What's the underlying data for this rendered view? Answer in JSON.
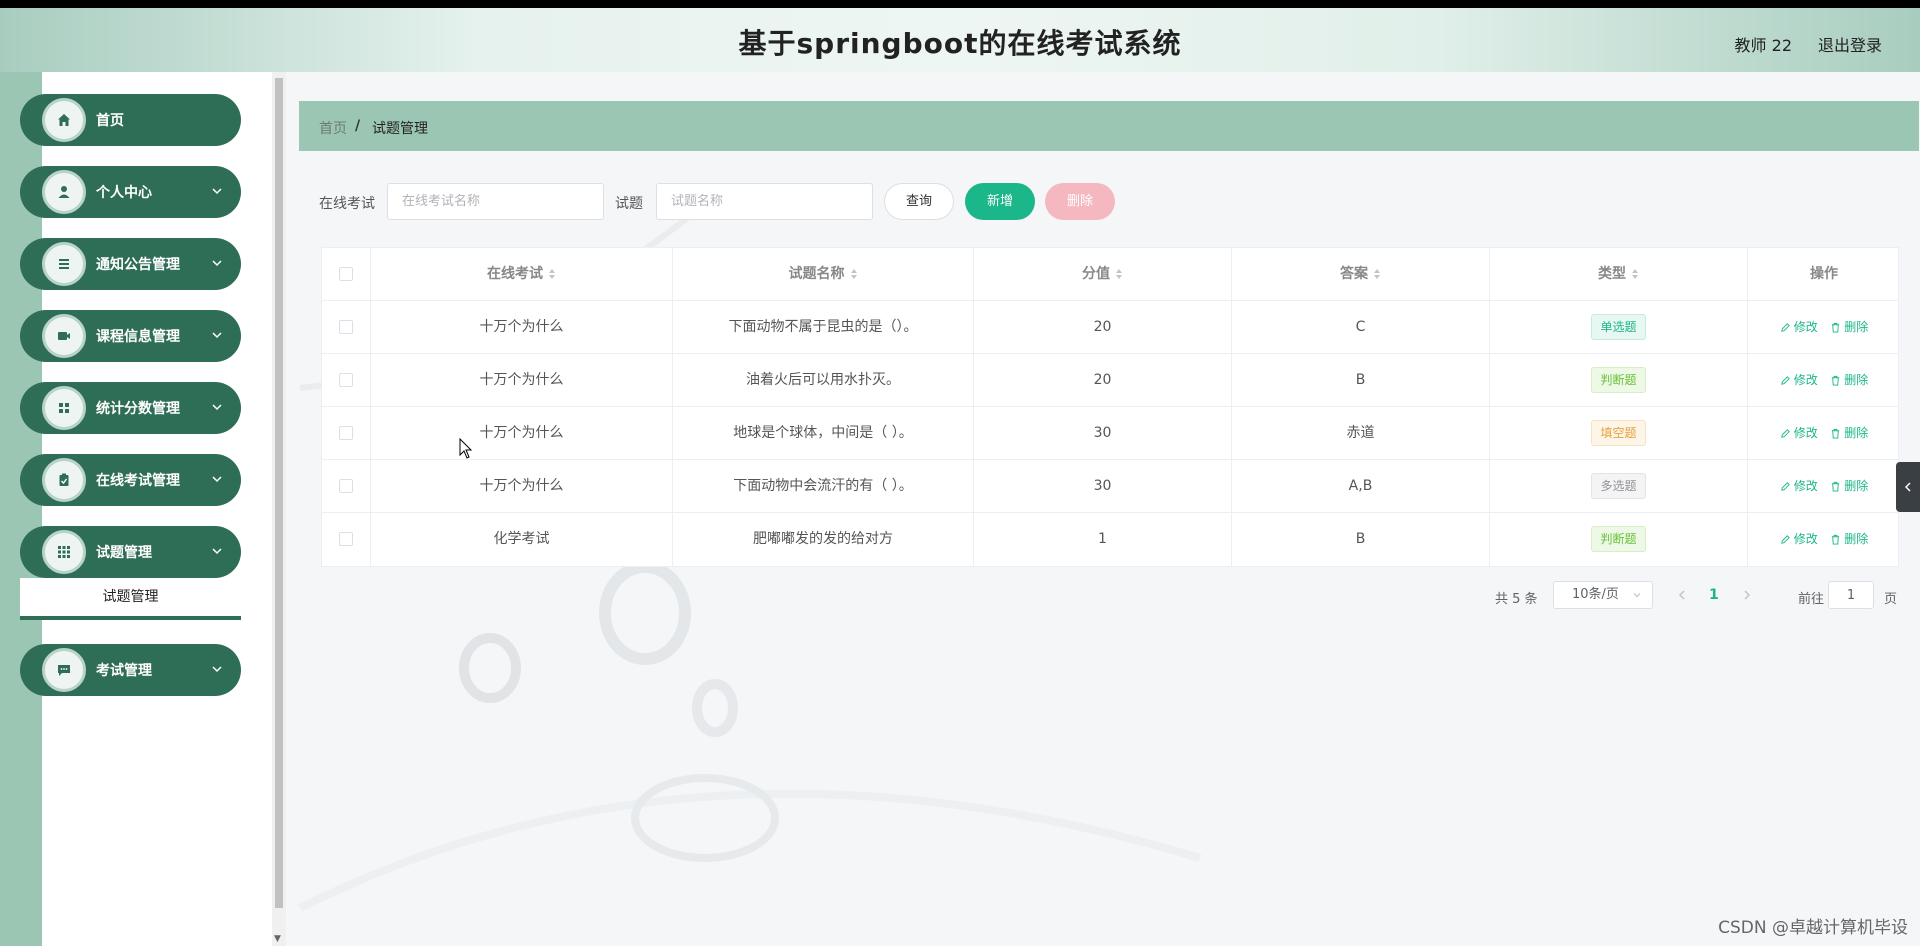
{
  "header": {
    "title": "基于springboot的在线考试系统",
    "user": "教师 22",
    "logout": "退出登录"
  },
  "sidebar": {
    "items": [
      {
        "label": "首页",
        "icon": "home-icon"
      },
      {
        "label": "个人中心",
        "icon": "user-icon"
      },
      {
        "label": "通知公告管理",
        "icon": "list-icon"
      },
      {
        "label": "课程信息管理",
        "icon": "video-icon"
      },
      {
        "label": "统计分数管理",
        "icon": "grid-icon"
      },
      {
        "label": "在线考试管理",
        "icon": "clipboard-icon"
      },
      {
        "label": "试题管理",
        "icon": "apps-icon"
      },
      {
        "label": "考试管理",
        "icon": "chat-icon"
      }
    ],
    "subitem": "试题管理"
  },
  "breadcrumb": {
    "home": "首页",
    "separator": "/",
    "current": "试题管理"
  },
  "search": {
    "exam_label": "在线考试",
    "exam_placeholder": "在线考试名称",
    "question_label": "试题",
    "question_placeholder": "试题名称",
    "query_btn": "查询",
    "add_btn": "新增",
    "delete_btn": "删除"
  },
  "table": {
    "headers": [
      "在线考试",
      "试题名称",
      "分值",
      "答案",
      "类型",
      "操作"
    ],
    "edit_label": "修改",
    "delete_label": "删除",
    "rows": [
      {
        "exam": "十万个为什么",
        "question": "下面动物不属于昆虫的是（）。",
        "score": "20",
        "answer": "C",
        "type": "单选题",
        "type_key": "single"
      },
      {
        "exam": "十万个为什么",
        "question": "油着火后可以用水扑灭。",
        "score": "20",
        "answer": "B",
        "type": "判断题",
        "type_key": "judge"
      },
      {
        "exam": "十万个为什么",
        "question": "地球是个球体，中间是（ ）。",
        "score": "30",
        "answer": "赤道",
        "type": "填空题",
        "type_key": "fill"
      },
      {
        "exam": "十万个为什么",
        "question": "下面动物中会流汗的有（ ）。",
        "score": "30",
        "answer": "A,B",
        "type": "多选题",
        "type_key": "multi"
      },
      {
        "exam": "化学考试",
        "question": "肥嘟嘟发的发的给对方",
        "score": "1",
        "answer": "B",
        "type": "判断题",
        "type_key": "judge"
      }
    ]
  },
  "pagination": {
    "total": "共 5 条",
    "page_size": "10条/页",
    "current_page": "1",
    "goto_label": "前往",
    "goto_value": "1",
    "page_suffix": "页"
  },
  "watermark": "CSDN @卓越计算机毕设",
  "colors": {
    "primary": "#2f6e56",
    "accent": "#1bb68a",
    "breadcrumb_bg": "#9cc6b4"
  }
}
